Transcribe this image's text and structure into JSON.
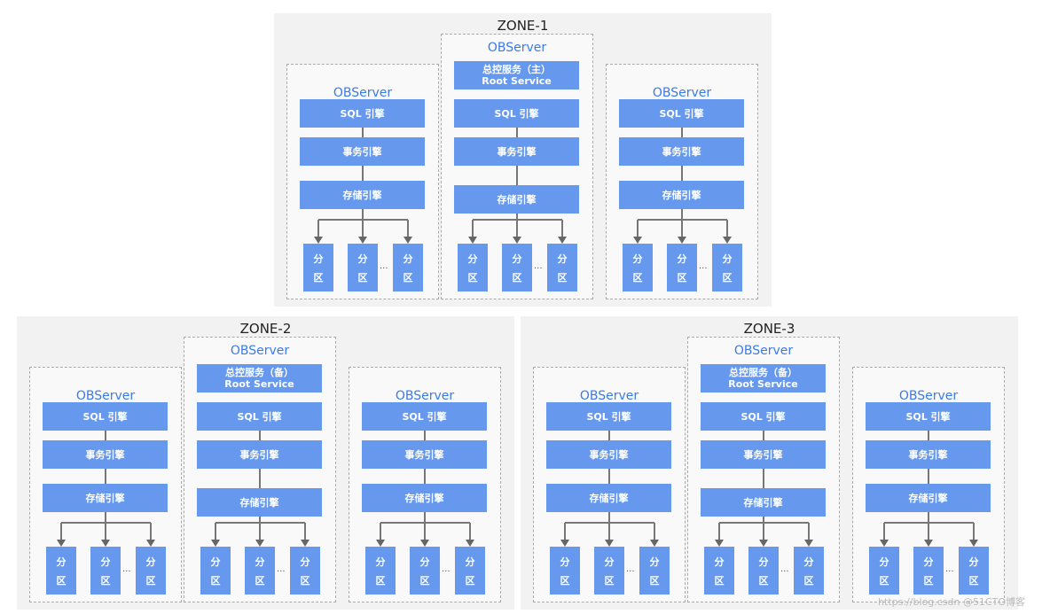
{
  "zones": [
    {
      "name": "ZONE-1",
      "servers": [
        {
          "title": "OBServer",
          "root": null
        },
        {
          "title": "OBServer",
          "root": [
            "总控服务（主）",
            "Root Service"
          ]
        },
        {
          "title": "OBServer",
          "root": null
        }
      ]
    },
    {
      "name": "ZONE-2",
      "servers": [
        {
          "title": "OBServer",
          "root": null
        },
        {
          "title": "OBServer",
          "root": [
            "总控服务（备）",
            "Root Service"
          ]
        },
        {
          "title": "OBServer",
          "root": null
        }
      ]
    },
    {
      "name": "ZONE-3",
      "servers": [
        {
          "title": "OBServer",
          "root": null
        },
        {
          "title": "OBServer",
          "root": [
            "总控服务（备）",
            "Root Service"
          ]
        },
        {
          "title": "OBServer",
          "root": null
        }
      ]
    }
  ],
  "blocks": {
    "sql": "SQL 引擎",
    "transaction": "事务引擎",
    "storage": "存储引擎"
  },
  "partition": [
    "分",
    "区"
  ],
  "ellipsis": "...",
  "colors": {
    "block": "#6699ee",
    "title": "#3b7be8",
    "zone_bg": "#f2f2f2"
  },
  "watermark": "https://blog.csdn @51CTO博客"
}
